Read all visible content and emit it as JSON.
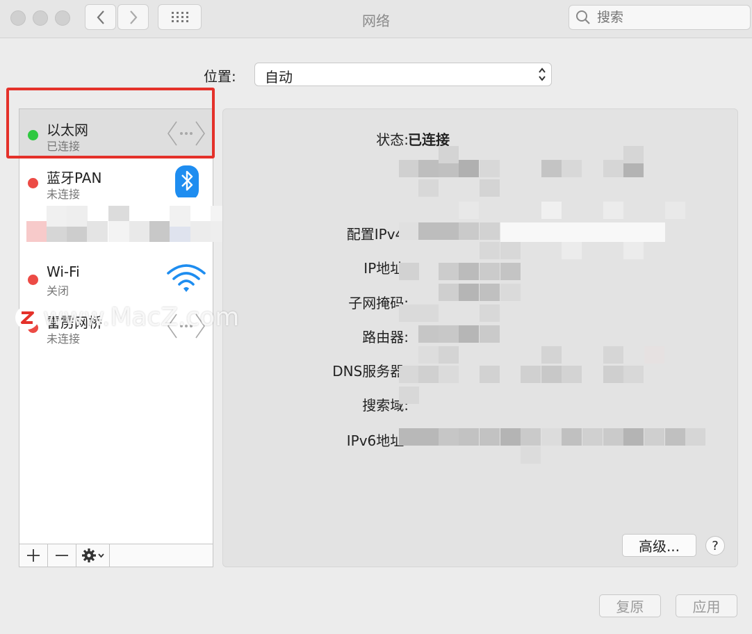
{
  "window": {
    "title": "网络"
  },
  "search": {
    "placeholder": "搜索"
  },
  "location": {
    "label": "位置:",
    "value": "自动"
  },
  "services": [
    {
      "name": "以太网",
      "status": "已连接",
      "status_color": "#2fc840",
      "icon": "ethernet-icon"
    },
    {
      "name": "蓝牙PAN",
      "status": "未连接",
      "status_color": "#ec4b45",
      "icon": "bluetooth-icon"
    },
    {
      "name": "Wi-Fi",
      "status": "关闭",
      "status_color": "#ec4b45",
      "icon": "wifi-icon"
    },
    {
      "name": "雷雳网桥",
      "status": "未连接",
      "status_color": "#ec4b45",
      "icon": "ethernet-icon"
    }
  ],
  "details": {
    "status_label": "状态:",
    "status_value": "已连接",
    "ipv4_config_label": "配置IPv4:",
    "ip_label": "IP地址:",
    "subnet_label": "子网掩码:",
    "router_label": "路由器:",
    "dns_label": "DNS服务器:",
    "search_domain_label": "搜索域:",
    "ipv6_label": "IPv6地址:"
  },
  "buttons": {
    "advanced": "高级...",
    "help": "?",
    "revert": "复原",
    "apply": "应用"
  },
  "watermark": {
    "text": "www.MacZ.com"
  }
}
